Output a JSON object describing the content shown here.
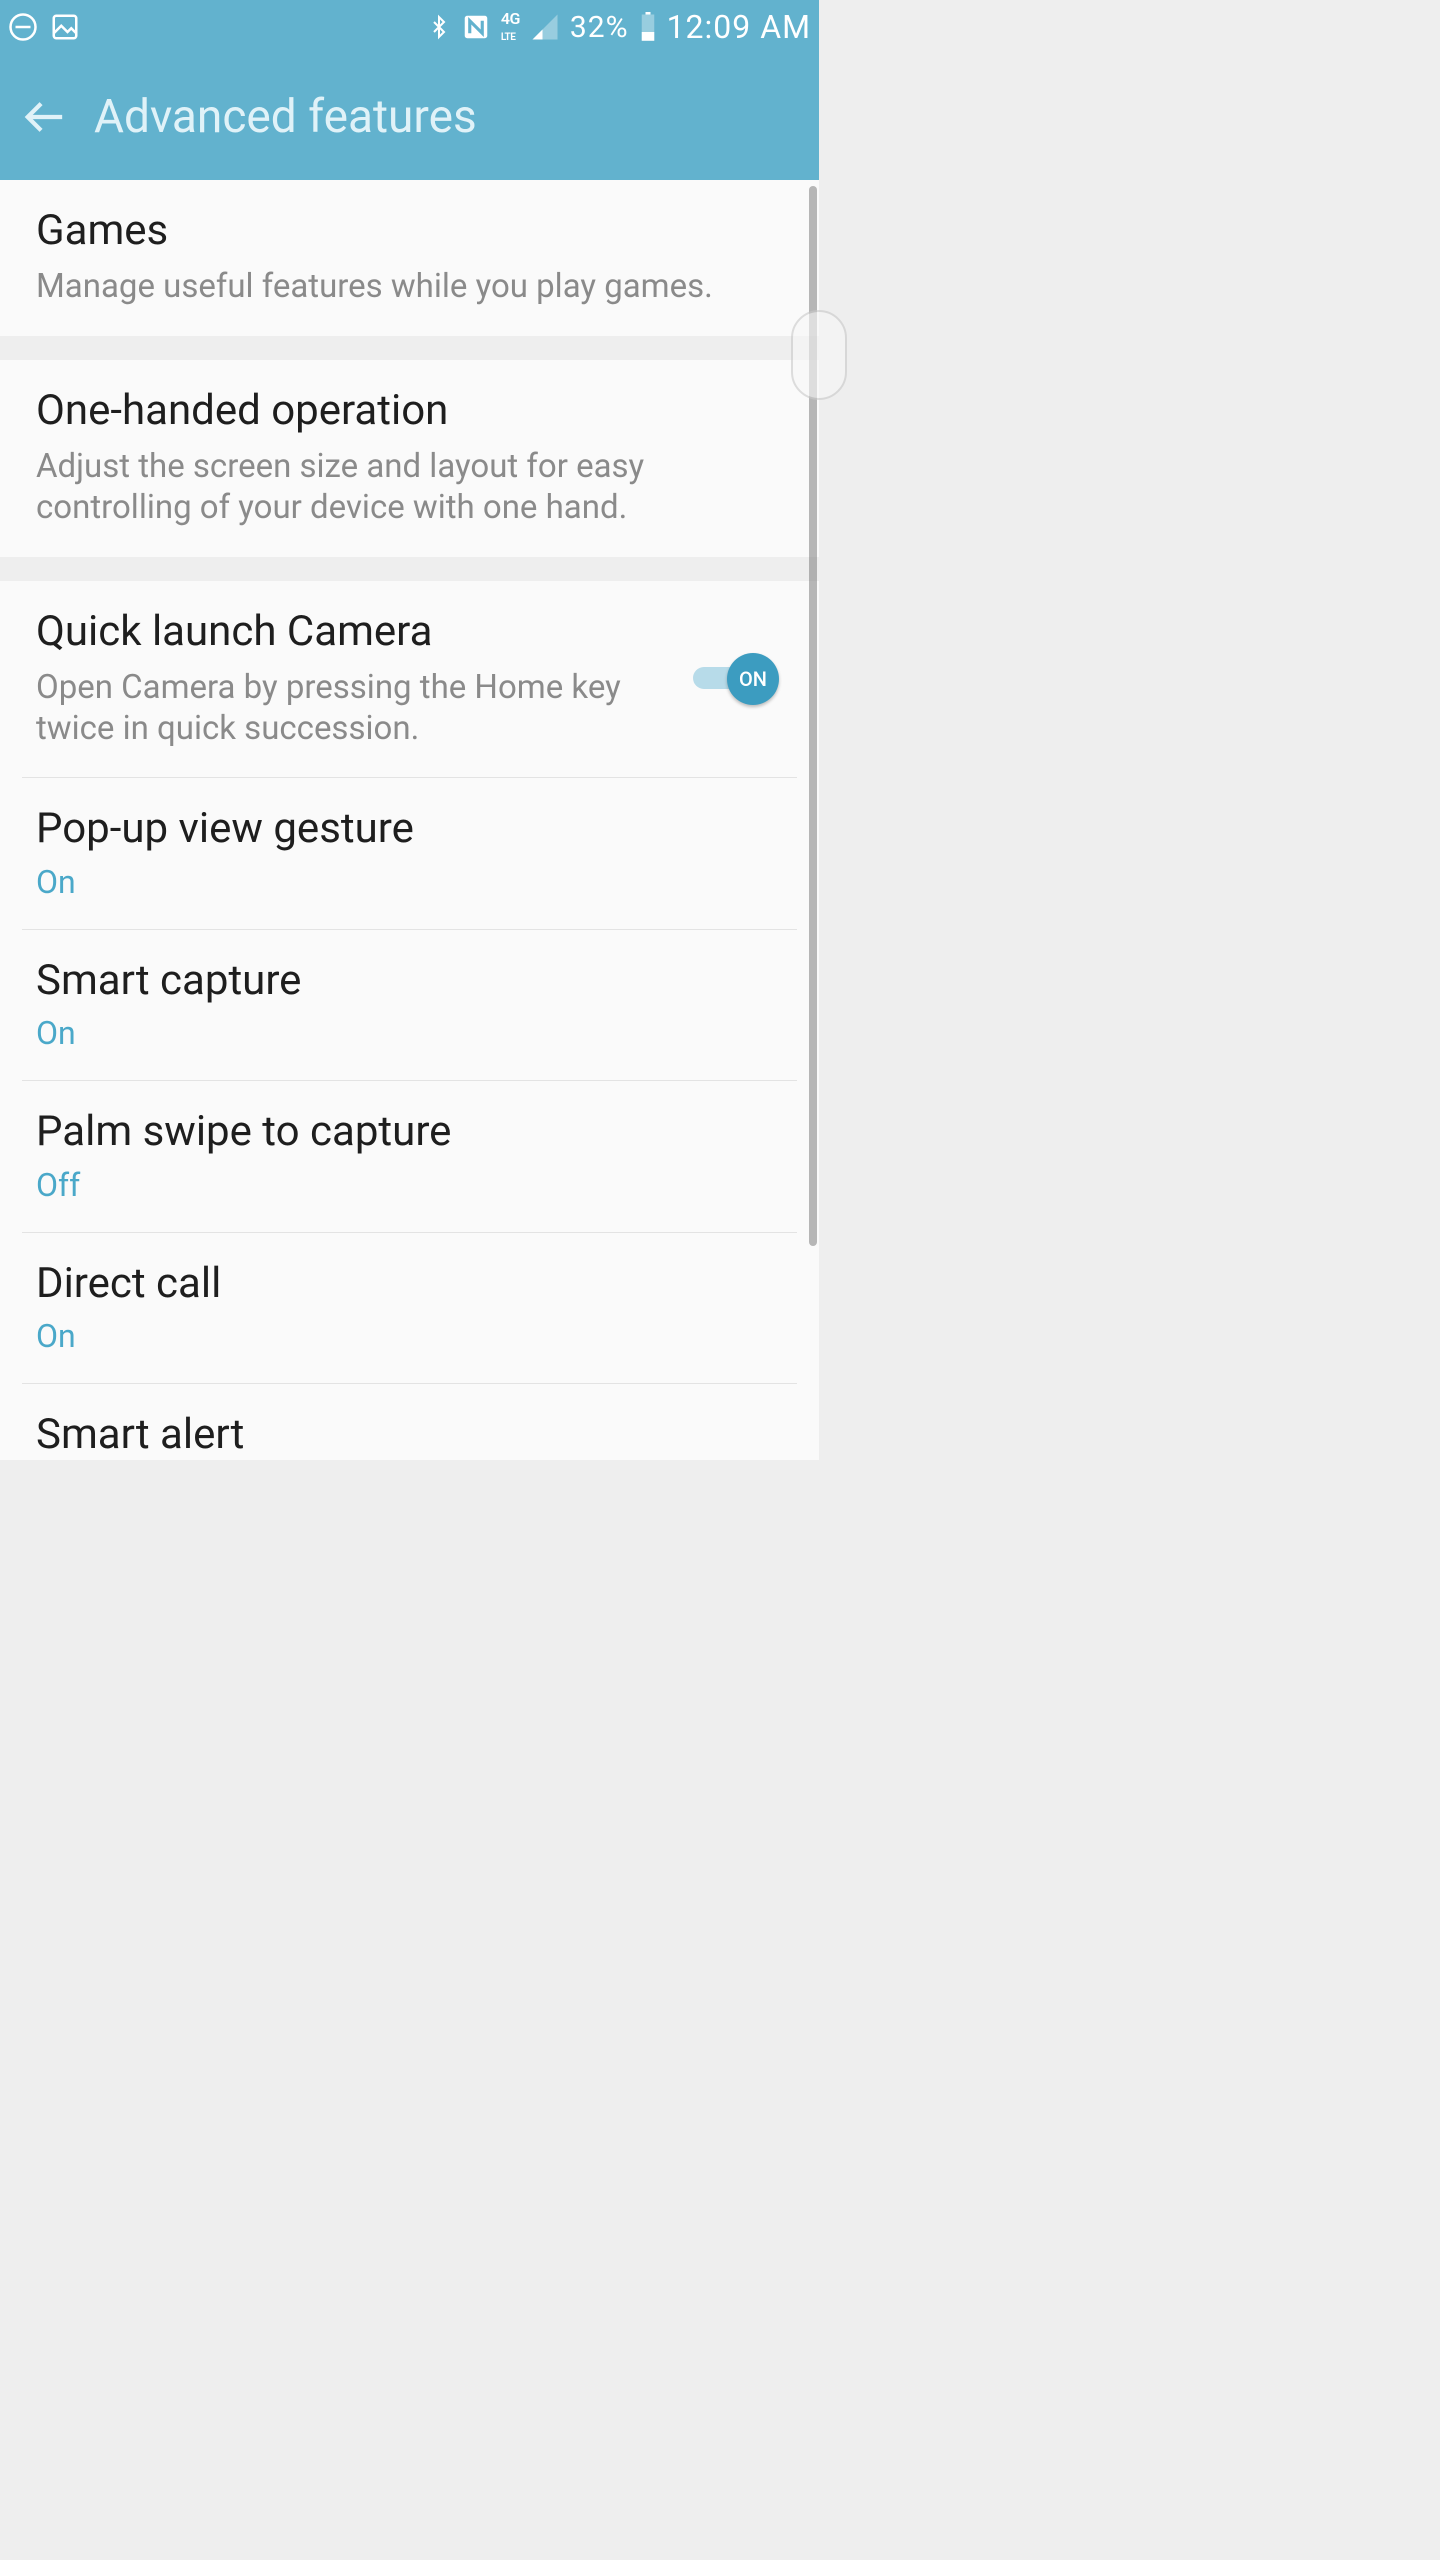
{
  "status": {
    "battery_percent": "32%",
    "time": "12:09 AM",
    "network_label": "4G LTE"
  },
  "appbar": {
    "title": "Advanced features"
  },
  "sections": {
    "games": {
      "title": "Games",
      "sub": "Manage useful features while you play games."
    },
    "one_handed": {
      "title": "One-handed operation",
      "sub": "Adjust the screen size and layout for easy controlling of your device with one hand."
    }
  },
  "list": {
    "quick_launch_camera": {
      "title": "Quick launch Camera",
      "sub": "Open Camera by pressing the Home key twice in quick succession.",
      "toggle_label": "ON"
    },
    "popup_view_gesture": {
      "title": "Pop-up view gesture",
      "status": "On"
    },
    "smart_capture": {
      "title": "Smart capture",
      "status": "On"
    },
    "palm_swipe": {
      "title": "Palm swipe to capture",
      "status": "Off"
    },
    "direct_call": {
      "title": "Direct call",
      "status": "On"
    },
    "smart_alert": {
      "title": "Smart alert"
    }
  }
}
